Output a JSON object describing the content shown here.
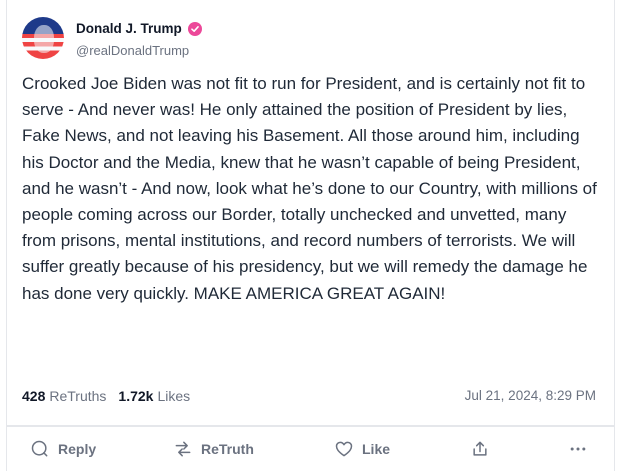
{
  "post": {
    "author_name": "Donald J. Trump",
    "handle": "@realDonaldTrump",
    "text": "Crooked Joe Biden was not fit to run for President, and is certainly not fit to serve - And never was! He only attained the position of President by lies, Fake News, and not leaving his Basement. All those around him, including his Doctor and the Media, knew that he wasn’t capable of being President, and he wasn’t - And now, look what he’s done to our Country, with millions of people coming across our Border, totally unchecked and unvetted, many from prisons, mental institutions, and record numbers of terrorists. We will suffer greatly because of his presidency, but we will remedy the damage he has done very quickly. MAKE AMERICA GREAT AGAIN!",
    "retruths_count": "428",
    "retruths_label": "ReTruths",
    "likes_count": "1.72k",
    "likes_label": "Likes",
    "timestamp": "Jul 21, 2024, 8:29 PM"
  },
  "actions": {
    "reply": "Reply",
    "retruth": "ReTruth",
    "like": "Like"
  },
  "icons": {
    "verified": "verified-badge-icon",
    "reply": "reply-bubble-icon",
    "retruth": "retruth-arrows-icon",
    "like": "heart-icon",
    "share": "share-icon",
    "more": "more-dots-icon"
  },
  "colors": {
    "verified_badge": "#ec4899",
    "muted_text": "#6b7280"
  }
}
